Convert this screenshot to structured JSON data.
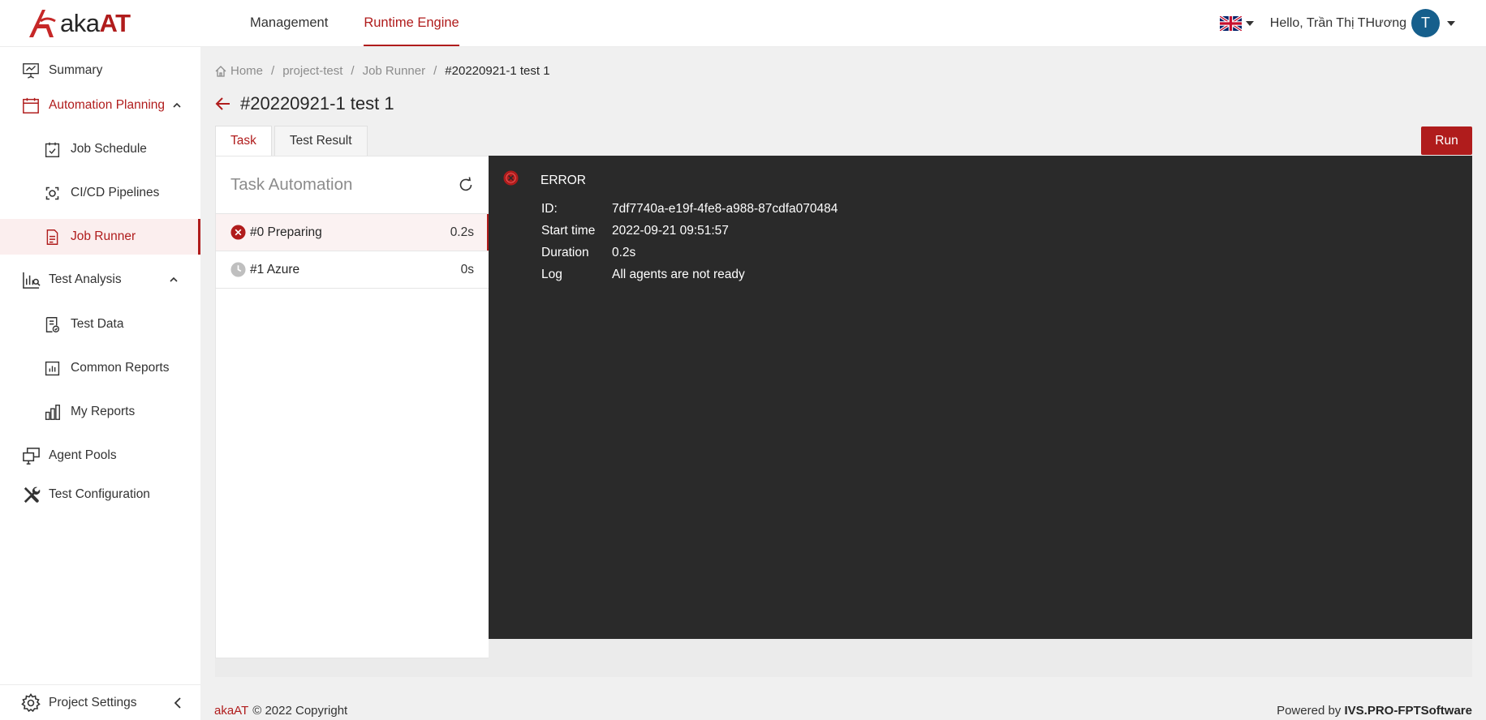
{
  "app": {
    "logo_text_prefix": "aka",
    "logo_text_suffix": "AT"
  },
  "topnav": [
    {
      "label": "Management"
    },
    {
      "label": "Runtime Engine"
    }
  ],
  "user": {
    "greeting": "Hello, Trần Thị THương",
    "avatar_initial": "T"
  },
  "sidebar": {
    "items": [
      {
        "label": "Summary",
        "icon": "presentation-chart-icon"
      },
      {
        "label": "Automation Planning",
        "icon": "calendar-icon"
      },
      {
        "label": "Job Schedule",
        "icon": "calendar-check-icon"
      },
      {
        "label": "CI/CD Pipelines",
        "icon": "pipeline-icon"
      },
      {
        "label": "Job Runner",
        "icon": "document-icon"
      },
      {
        "label": "Test Analysis",
        "icon": "analysis-icon"
      },
      {
        "label": "Test Data",
        "icon": "data-file-icon"
      },
      {
        "label": "Common Reports",
        "icon": "bar-chart-icon"
      },
      {
        "label": "My Reports",
        "icon": "my-reports-icon"
      },
      {
        "label": "Agent Pools",
        "icon": "monitors-icon"
      },
      {
        "label": "Test Configuration",
        "icon": "tools-icon"
      }
    ],
    "bottom_label": "Project Settings"
  },
  "breadcrumb": {
    "home": "Home",
    "project": "project-test",
    "section": "Job Runner",
    "current": "#20220921-1 test 1"
  },
  "page": {
    "title": "#20220921-1 test 1",
    "tabs": [
      {
        "label": "Task"
      },
      {
        "label": "Test Result"
      }
    ],
    "run_label": "Run"
  },
  "task_panel": {
    "title": "Task Automation",
    "tasks": [
      {
        "label": "#0 Preparing",
        "duration": "0.2s",
        "status": "error"
      },
      {
        "label": "#1 Azure",
        "duration": "0s",
        "status": "pending"
      }
    ]
  },
  "console": {
    "status": "ERROR",
    "fields": [
      {
        "key": "ID:",
        "value": "7df7740a-e19f-4fe8-a988-87cdfa070484"
      },
      {
        "key": "Start time",
        "value": "2022-09-21 09:51:57"
      },
      {
        "key": "Duration",
        "value": "0.2s"
      },
      {
        "key": "Log",
        "value": "All agents are not ready"
      }
    ]
  },
  "footer": {
    "brand": "akaAT",
    "copyright": "© 2022 Copyright",
    "powered_prefix": "Powered by",
    "powered_by": "IVS.PRO-FPTSoftware"
  },
  "colors": {
    "accent": "#b01c1c",
    "console_bg": "#2a2a2a",
    "avatar": "#165f8c"
  }
}
